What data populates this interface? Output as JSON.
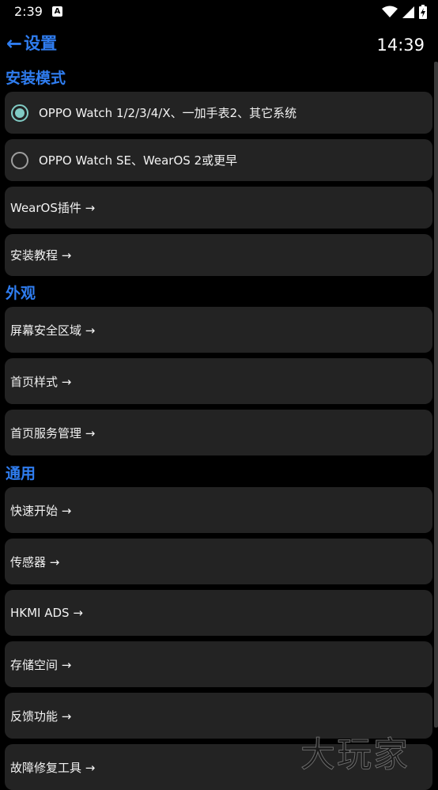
{
  "status_bar": {
    "time": "2:39",
    "notif_letter": "A",
    "icons": [
      "wifi-icon",
      "signal-icon",
      "battery-icon"
    ]
  },
  "header": {
    "back_arrow": "←",
    "title": "设置",
    "clock": "14:39"
  },
  "sections": {
    "install_mode": {
      "title": "安装模式",
      "options": [
        {
          "label": "OPPO Watch 1/2/3/4/X、一加手表2、其它系统",
          "selected": true
        },
        {
          "label": "OPPO Watch SE、WearOS 2或更早",
          "selected": false
        }
      ],
      "items": [
        "WearOS插件 →",
        "安装教程 →"
      ]
    },
    "appearance": {
      "title": "外观",
      "items": [
        "屏幕安全区域 →",
        "首页样式 →",
        "首页服务管理 →"
      ]
    },
    "general": {
      "title": "通用",
      "items": [
        "快速开始 →",
        "传感器 →",
        "HKMI ADS →",
        "存储空间 →",
        "反馈功能 →",
        "故障修复工具 →"
      ]
    }
  },
  "watermark": "大玩家",
  "colors": {
    "accent": "#2f7df0",
    "radio_selected": "#80cbc4",
    "card_bg": "#232323",
    "background": "#000000"
  }
}
